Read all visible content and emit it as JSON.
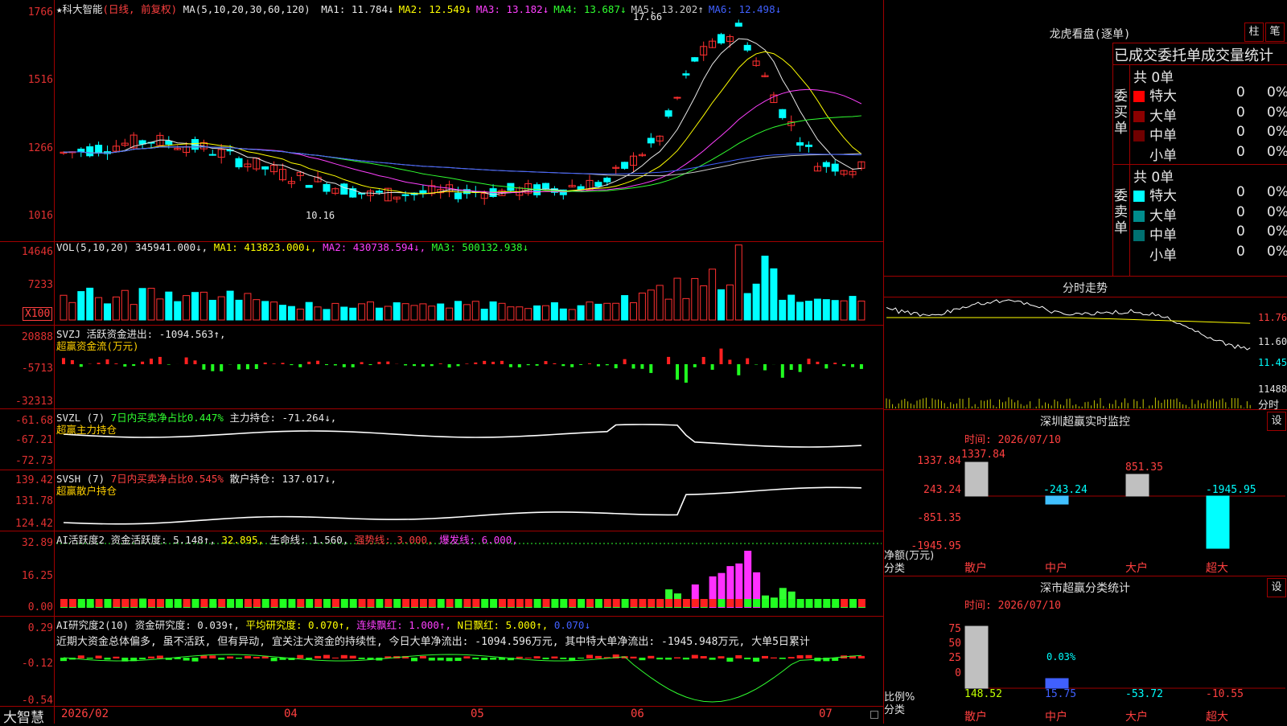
{
  "stock": {
    "name": "★科大智能",
    "mode": "(日线, 前复权)",
    "ma_header": "MA(5,10,20,30,60,120)",
    "ma": [
      {
        "label": "MA1: 11.784",
        "arrow": "↓",
        "color": "#e8e8e8"
      },
      {
        "label": "MA2: 12.549",
        "arrow": "↓",
        "color": "#ffff00"
      },
      {
        "label": "MA3: 13.182",
        "arrow": "↓",
        "color": "#ff40ff"
      },
      {
        "label": "MA4: 13.687",
        "arrow": "↓",
        "color": "#30ff30"
      },
      {
        "label": "MA5: 13.202",
        "arrow": "↑",
        "color": "#c8c8c8"
      },
      {
        "label": "MA6: 12.498",
        "arrow": "↓",
        "color": "#4060ff"
      }
    ],
    "y_ticks": [
      "1766",
      "1516",
      "1266",
      "1016"
    ],
    "high_label": "17.66",
    "low_label": "10.16"
  },
  "volume": {
    "header": "VOL(5,10,20)",
    "value": "345941.000↓,",
    "ma1": "MA1: 413823.000↓,",
    "ma2": "MA2: 430738.594↓,",
    "ma3": "MA3: 500132.938↓",
    "y_ticks": [
      "14646",
      "7233"
    ],
    "unit_badge": "X100"
  },
  "svzj": {
    "header": "SVZJ",
    "text": "活跃资金进出: -1094.563↑,",
    "subtitle": "超赢资金流(万元)",
    "y_ticks": [
      "20888",
      "-5713",
      "-32313"
    ]
  },
  "svzl": {
    "header": "SVZL (7)",
    "text1": "7日内买卖净占比0.447%",
    "text2": "主力持仓: -71.264↓,",
    "subtitle": "超赢主力持仓",
    "y_ticks": [
      "-61.68",
      "-67.21",
      "-72.73"
    ]
  },
  "svsh": {
    "header": "SVSH (7)",
    "text1": "7日内买卖净占比0.545%",
    "text2": "散户持仓: 137.017↓,",
    "subtitle": "超赢散户持仓",
    "y_ticks": [
      "139.42",
      "131.78",
      "124.42"
    ]
  },
  "ai1": {
    "header": "AI活跃度2",
    "t1": "资金活跃度: 5.148↑,",
    "t2": "32.895,",
    "t3": "生命线: 1.560,",
    "t4": "强势线: 3.000,",
    "t5": "爆发线: 6.000,",
    "y_ticks": [
      "32.89",
      "16.25",
      "0.00"
    ]
  },
  "ai2": {
    "header": "AI研究度2(10)",
    "t1": "资金研究度: 0.039↑,",
    "t2": "平均研究度: 0.070↑,",
    "t3": "连续飘红: 1.000↑,",
    "t4": "N日飘红: 5.000↑,",
    "t5": "0.070↓",
    "comment": "近期大资金总体偏多, 虽不活跃, 但有异动, 宜关注大资金的持续性, 今日大单净流出: -1094.596万元, 其中特大单净流出: -1945.948万元, 大单5日累计",
    "y_ticks": [
      "0.29",
      "-0.12",
      "-0.54"
    ]
  },
  "bottom": {
    "brand": "大智慧",
    "dates": [
      "2026/02",
      "04",
      "05",
      "06",
      "07"
    ]
  },
  "right": {
    "lhb_title": "龙虎看盘(逐单)",
    "btn_zhu": "柱",
    "btn_bi": "笔",
    "order_title": "已成交委托单成交量统计",
    "buy_label": "委买单",
    "sell_label": "委卖单",
    "buy_total": "共 0单",
    "sell_total": "共 0单",
    "buy_rows": [
      {
        "name": "特大",
        "count": "0",
        "pct": "0%",
        "color": "#ff0000"
      },
      {
        "name": "大单",
        "count": "0",
        "pct": "0%",
        "color": "#8b0000"
      },
      {
        "name": "中单",
        "count": "0",
        "pct": "0%",
        "color": "#700000"
      },
      {
        "name": "小单",
        "count": "0",
        "pct": "0%",
        "color": "#000000"
      }
    ],
    "sell_rows": [
      {
        "name": "特大",
        "count": "0",
        "pct": "0%",
        "color": "#00ffff"
      },
      {
        "name": "大单",
        "count": "0",
        "pct": "0%",
        "color": "#008b8b"
      },
      {
        "name": "中单",
        "count": "0",
        "pct": "0%",
        "color": "#007070"
      },
      {
        "name": "小单",
        "count": "0",
        "pct": "0%",
        "color": "#000000"
      }
    ],
    "intraday_title": "分时走势",
    "intraday_ticks": [
      "11.76",
      "11.60",
      "11.45"
    ],
    "intraday_vol": "11488",
    "intraday_label": "分时",
    "monitor_title": "深圳超赢实时监控",
    "monitor_btn": "设",
    "monitor_time": "时间: 2026/07/10",
    "monitor_ticks": [
      "1337.84",
      "243.24",
      "-851.35",
      "-1945.95"
    ],
    "monitor_values": {
      "san": "1337.84",
      "zhong": "-243.24",
      "da": "851.35",
      "chao": "-1945.95"
    },
    "monitor_unit": "净额(万元)",
    "monitor_class": "分类",
    "cats": [
      "散户",
      "中户",
      "大户",
      "超大"
    ],
    "stat_title": "深市超赢分类统计",
    "stat_btn": "设",
    "stat_time": "时间: 2026/07/10",
    "stat_ticks": [
      "75",
      "50",
      "25",
      "0"
    ],
    "stat_bar_label": "0.03%",
    "stat_unit": "比例%",
    "stat_class": "分类",
    "stat_values": [
      "148.52",
      "15.75",
      "-53.72",
      "-10.55"
    ],
    "stat_bars": {
      "san": 100,
      "zhong": 15.75
    }
  }
}
